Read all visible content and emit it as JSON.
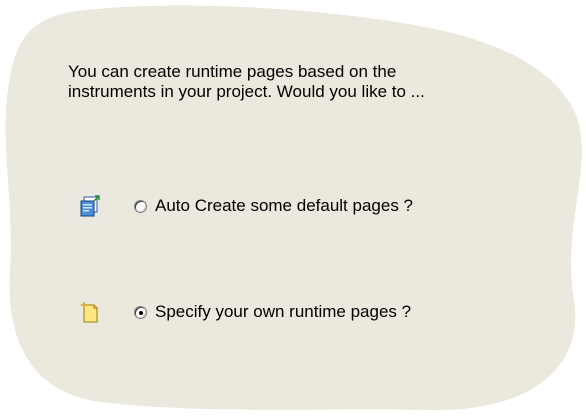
{
  "prompt": {
    "line1": "You can create runtime pages based on the",
    "line2": "instruments in your project.  Would you like to ..."
  },
  "options": [
    {
      "label": "Auto Create some default pages ?",
      "selected": false,
      "icon": "auto-create-pages-icon"
    },
    {
      "label": "Specify your own runtime pages ?",
      "selected": true,
      "icon": "new-page-icon"
    }
  ],
  "colors": {
    "panel": "#ebe8de",
    "page_background": "#ffffff"
  }
}
